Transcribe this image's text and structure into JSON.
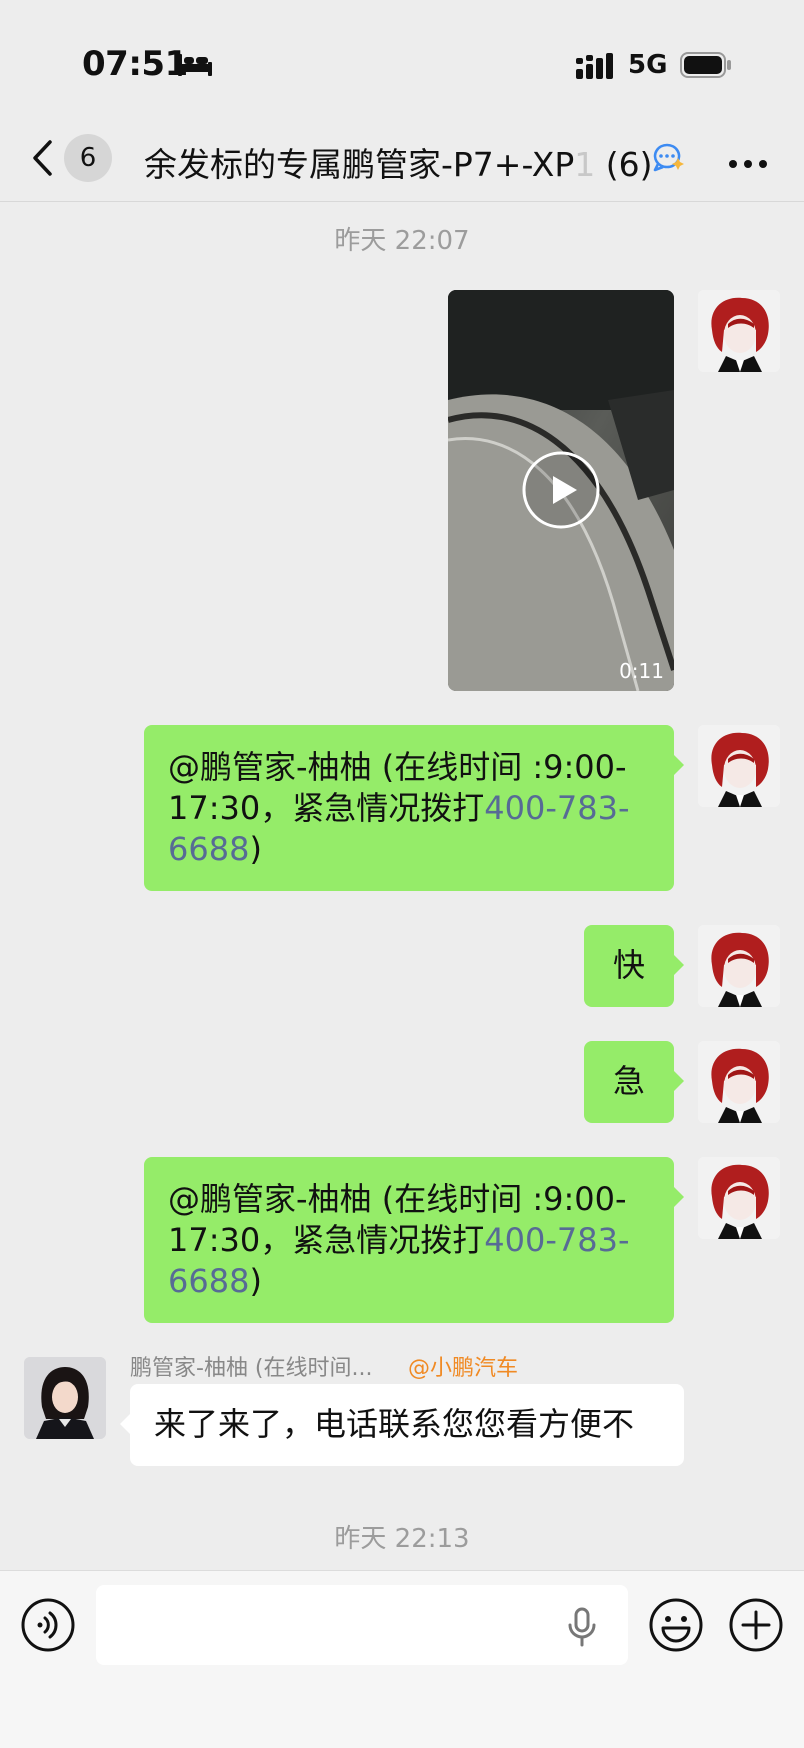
{
  "status_bar": {
    "time": "07:51",
    "network": "5G",
    "icons": [
      "bed-icon",
      "signal-icon",
      "battery-icon"
    ]
  },
  "nav": {
    "unread_count": "6",
    "title": "余发标的专属鹏管家-P7+-XP",
    "title_faded": "1",
    "member_count": "(6)",
    "icons": [
      "back-icon",
      "group-chat-icon",
      "more-icon"
    ]
  },
  "messages": {
    "ts1": "昨天 22:07",
    "video_duration": "0:11",
    "msg1_text": "@鹏管家-柚柚 (在线时间 :9:00-17:30，紧急情况拨打",
    "msg1_phone": "400-783-6688",
    "msg1_tail": ")",
    "msg2_text": "快",
    "msg3_text": "急",
    "msg4_text": "@鹏管家-柚柚 (在线时间 :9:00-17:30，紧急情况拨打",
    "msg4_phone": "400-783-6688",
    "msg4_tail": ")",
    "sender_name": "鹏管家-柚柚 (在线时间...",
    "sender_tag": "@小鹏汽车",
    "reply_text": "来了来了，电话联系您您看方便不",
    "ts2": "昨天 22:13"
  },
  "input_bar": {
    "placeholder": "",
    "icons": [
      "voice-icon",
      "mic-icon",
      "emoji-icon",
      "plus-icon"
    ]
  },
  "colors": {
    "background": "#ededed",
    "sent_bubble": "#95ec69",
    "received_bubble": "#ffffff",
    "phone_link": "#576b95",
    "sender_tag": "#f08a24"
  }
}
